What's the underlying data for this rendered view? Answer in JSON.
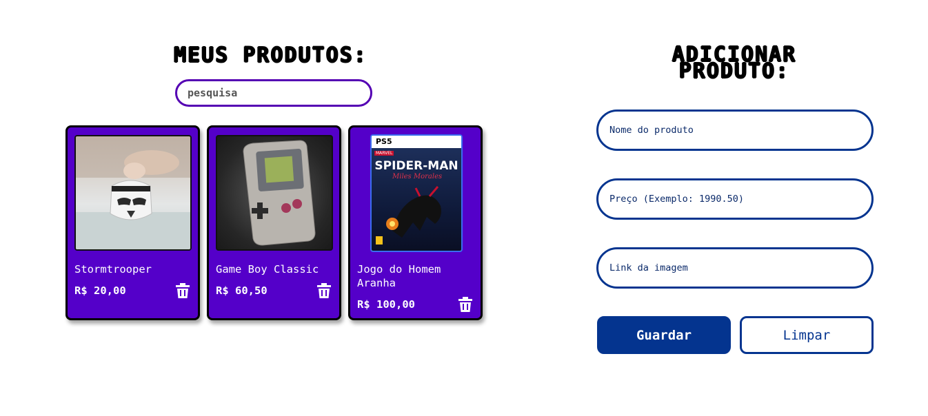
{
  "products_section": {
    "title": "MEUS PRODUTOS:",
    "search": {
      "placeholder": "pesquisa",
      "value": ""
    },
    "products": [
      {
        "name": "Stormtrooper",
        "price": "R$ 20,00",
        "image": "stormtrooper-mug-photo",
        "delete_icon": "trash-icon"
      },
      {
        "name": "Game Boy Classic",
        "price": "R$ 60,50",
        "image": "game-boy-photo",
        "delete_icon": "trash-icon"
      },
      {
        "name": "Jogo do Homem Aranha",
        "price": "R$ 100,00",
        "image": "spider-man-game-cover",
        "delete_icon": "trash-icon",
        "cover": {
          "platform": "PS5",
          "brand": "MARVEL",
          "title": "SPIDER-MAN",
          "subtitle": "Miles Morales"
        }
      }
    ]
  },
  "form_section": {
    "title": "ADICIONAR PRODUTO:",
    "fields": {
      "name": {
        "placeholder": "Nome do produto"
      },
      "price": {
        "placeholder": "Preço (Exemplo: 1990.50)"
      },
      "image": {
        "placeholder": "Link da imagem"
      }
    },
    "buttons": {
      "save": "Guardar",
      "clear": "Limpar"
    }
  },
  "colors": {
    "card_bg": "#5400c9",
    "search_border": "#5400b3",
    "form_accent": "#04348f",
    "text_light": "#ffffff"
  }
}
